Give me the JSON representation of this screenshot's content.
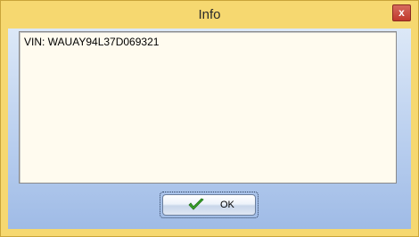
{
  "window": {
    "title": "Info",
    "close_label": "x"
  },
  "content": {
    "text": "VIN: WAUAY94L37D069321"
  },
  "buttons": {
    "ok_label": "OK",
    "ok_icon": "checkmark-icon"
  },
  "colors": {
    "titlebar": "#f6d870",
    "close_button": "#c0392b",
    "text_background": "#fffbef",
    "client_background": "#b7cdee",
    "checkmark": "#3aa52a"
  }
}
